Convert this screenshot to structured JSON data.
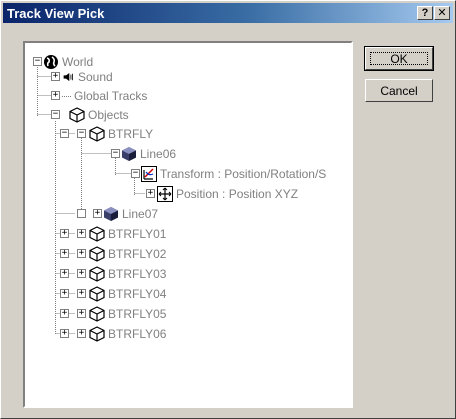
{
  "window": {
    "title": "Track View Pick",
    "help_label": "?",
    "close_label": "✕"
  },
  "buttons": {
    "ok": "OK",
    "cancel": "Cancel"
  },
  "tree": {
    "nodes": [
      {
        "label": "World",
        "icon": "globe-icon"
      },
      {
        "label": "Sound",
        "icon": "speaker-icon"
      },
      {
        "label": "Global Tracks",
        "icon": ""
      },
      {
        "label": "Objects",
        "icon": "object-icon"
      },
      {
        "label": "BTRFLY",
        "icon": "object-icon"
      },
      {
        "label": "Line06",
        "icon": "shape-icon"
      },
      {
        "label": "Transform : Position/Rotation/S",
        "icon": "transform-icon"
      },
      {
        "label": "Position : Position XYZ",
        "icon": "position-icon"
      },
      {
        "label": "Line07",
        "icon": "shape-icon"
      },
      {
        "label": "BTRFLY01",
        "icon": "object-icon"
      },
      {
        "label": "BTRFLY02",
        "icon": "object-icon"
      },
      {
        "label": "BTRFLY03",
        "icon": "object-icon"
      },
      {
        "label": "BTRFLY04",
        "icon": "object-icon"
      },
      {
        "label": "BTRFLY05",
        "icon": "object-icon"
      },
      {
        "label": "BTRFLY06",
        "icon": "object-icon"
      }
    ]
  }
}
